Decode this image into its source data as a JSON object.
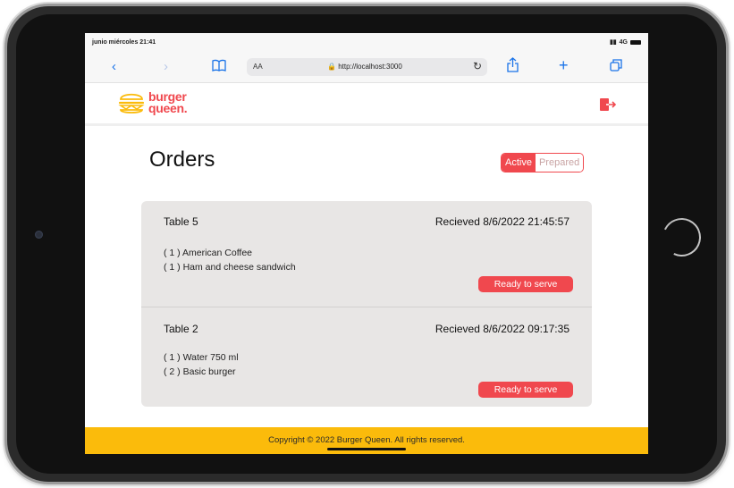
{
  "status_bar": {
    "time": "junio miércoles 21:41",
    "network": "4G"
  },
  "browser": {
    "text_size_label": "AA",
    "url": "http://localhost:3000",
    "icons": [
      "back-icon",
      "forward-icon",
      "bookmarks-icon",
      "lock-icon",
      "reload-icon",
      "share-icon",
      "new-tab-icon",
      "tabs-icon"
    ]
  },
  "app": {
    "logo_line1": "burger",
    "logo_line2": "queen.",
    "brand_color": "#f0484e",
    "accent_color": "#fbbb0b"
  },
  "page": {
    "title": "Orders",
    "toggle_active": "Active",
    "toggle_prepared": "Prepared"
  },
  "orders": [
    {
      "table": "Table 5",
      "received": "Recieved 8/6/2022 21:45:57",
      "items": [
        "( 1 ) American Coffee",
        "( 1 ) Ham and cheese sandwich"
      ],
      "action": "Ready to serve"
    },
    {
      "table": "Table 2",
      "received": "Recieved 8/6/2022 09:17:35",
      "items": [
        "( 1 ) Water 750 ml",
        "( 2 ) Basic burger"
      ],
      "action": "Ready to serve"
    }
  ],
  "footer": {
    "text": "Copyright © 2022 Burger Queen. All rights reserved."
  }
}
